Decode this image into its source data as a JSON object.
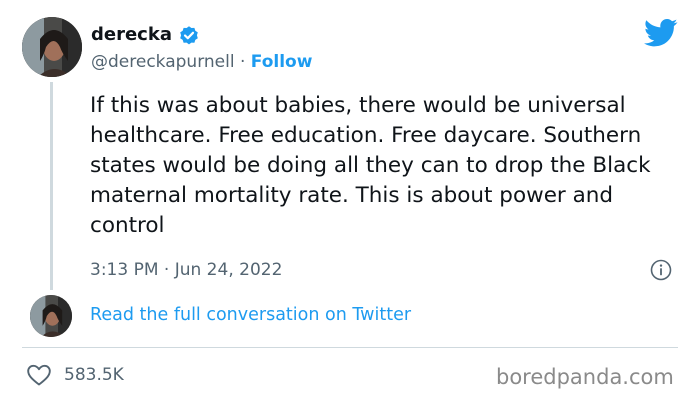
{
  "author": {
    "display_name": "derecka",
    "handle": "@dereckapurnell",
    "separator": " · ",
    "follow_label": "Follow",
    "verified": true
  },
  "tweet": {
    "text": "If this was about babies, there would be universal healthcare. Free education. Free daycare. Southern states would be doing all they can to drop the Black maternal mortality rate. This is about power and control",
    "time": "3:13 PM",
    "separator": " · ",
    "date": "Jun 24, 2022"
  },
  "conversation": {
    "link_label": "Read the full conversation on Twitter"
  },
  "engagement": {
    "likes": "583.5K"
  },
  "watermark": {
    "text": "boredpanda.com"
  },
  "icons": {
    "verified": "verified-badge-icon",
    "twitter": "twitter-bird-icon",
    "info": "info-icon",
    "like": "heart-icon"
  },
  "colors": {
    "accent": "#1d9bf0",
    "text_primary": "#0f1419",
    "text_secondary": "#536471",
    "divider": "#cfd9de"
  }
}
